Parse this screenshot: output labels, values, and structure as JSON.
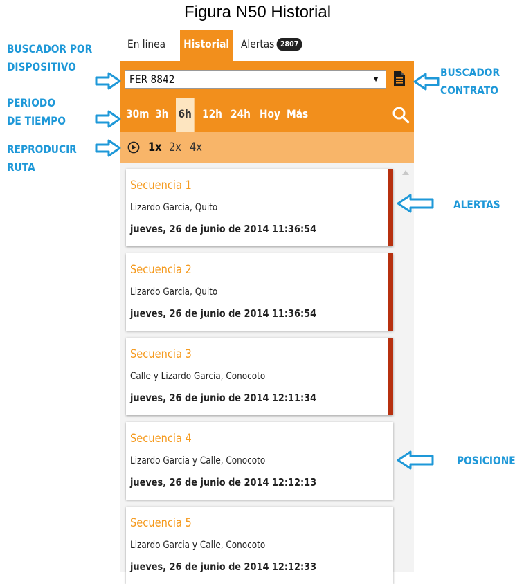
{
  "figure_title": "Figura N50 Historial",
  "tabs": {
    "online": "En línea",
    "historial": "Historial",
    "alertas": "Alertas",
    "alertas_count": "2807"
  },
  "device_search": {
    "value": "FER 8842"
  },
  "periods": [
    "30m",
    "3h",
    "6h",
    "12h",
    "24h",
    "Hoy",
    "Más"
  ],
  "period_selected": "6h",
  "speeds": [
    "1x",
    "2x",
    "4x"
  ],
  "speed_selected": "1x",
  "sequences": [
    {
      "title": "Secuencia 1",
      "address": "Lizardo Garcia, Quito",
      "date": "jueves, 26 de junio de 2014 11:36:54",
      "alert": true
    },
    {
      "title": "Secuencia 2",
      "address": "Lizardo Garcia, Quito",
      "date": "jueves, 26 de junio de 2014 11:36:54",
      "alert": true
    },
    {
      "title": "Secuencia 3",
      "address": "Calle y Lizardo Garcia, Conocoto",
      "date": "jueves, 26 de junio de 2014 12:11:34",
      "alert": true
    },
    {
      "title": "Secuencia 4",
      "address": "Lizardo Garcia y Calle, Conocoto",
      "date": "jueves, 26 de junio de 2014 12:12:13",
      "alert": false
    },
    {
      "title": "Secuencia 5",
      "address": "Lizardo Garcia y Calle, Conocoto",
      "date": "jueves, 26 de junio de 2014 12:12:33",
      "alert": false
    }
  ],
  "annotations": {
    "buscador_dispositivo": [
      "BUSCADOR POR",
      "DISPOSITIVO"
    ],
    "periodo": [
      "PERIODO",
      "DE TIEMPO"
    ],
    "reproducir": [
      "REPRODUCIR",
      "RUTA"
    ],
    "buscador_contrato": [
      "BUSCADOR",
      "CONTRATO"
    ],
    "alertas": "ALERTAS",
    "posiciones": "POSICIONES"
  },
  "colors": {
    "orange": "#f28f1c",
    "light_orange": "#f8b569",
    "sequence_title": "#f59a1e",
    "alert_bar": "#b7300f",
    "annotation_blue": "#1e98d8"
  },
  "icons": [
    "document-icon",
    "search-icon",
    "play-icon",
    "dropdown-arrow-icon",
    "arrow-right-icon",
    "arrow-left-icon",
    "scroll-up-icon"
  ]
}
